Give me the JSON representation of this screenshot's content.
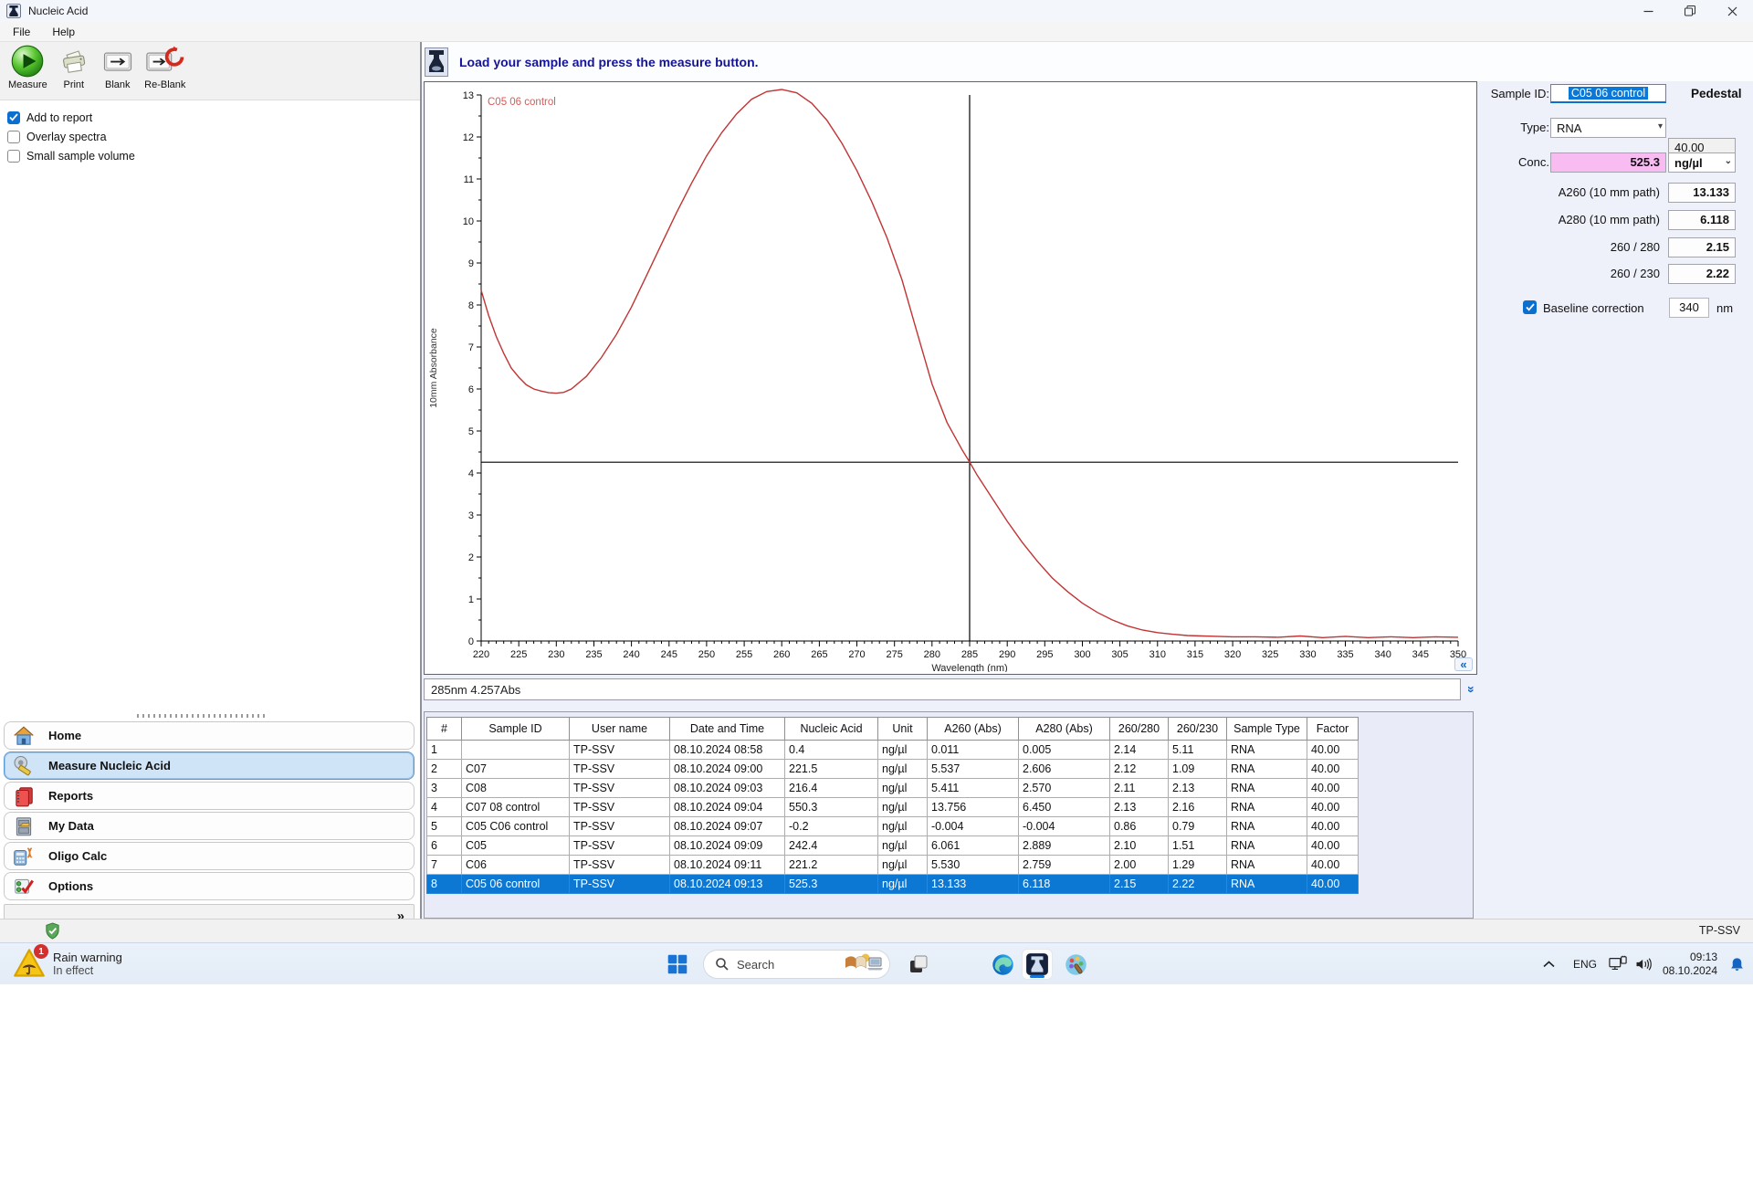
{
  "window": {
    "title": "Nucleic Acid",
    "menu": {
      "file": "File",
      "help": "Help"
    }
  },
  "toolbar": {
    "measure": "Measure",
    "print": "Print",
    "blank": "Blank",
    "reblank": "Re-Blank",
    "checkboxes": [
      {
        "label": "Add to report",
        "checked": true
      },
      {
        "label": "Overlay spectra",
        "checked": false
      },
      {
        "label": "Small sample volume",
        "checked": false
      }
    ]
  },
  "message": "Load your sample and press the measure button.",
  "chart_data": {
    "type": "line",
    "xlabel": "Wavelength (nm)",
    "ylabel": "10mm Absorbance",
    "xlim": [
      220,
      350
    ],
    "ylim": [
      0,
      13
    ],
    "x_major_tick": 5,
    "x_minor_tick": 1,
    "y_major_tick": 1,
    "y_minor_tick": 0.5,
    "grid": false,
    "legend_position": "top-left-inside",
    "series": [
      {
        "name": "C05 06 control",
        "color": "#c13434",
        "label_color": "#e05555",
        "points": [
          [
            220,
            8.35
          ],
          [
            221,
            7.75
          ],
          [
            222,
            7.25
          ],
          [
            223,
            6.85
          ],
          [
            224,
            6.5
          ],
          [
            225,
            6.28
          ],
          [
            226,
            6.1
          ],
          [
            227,
            6.0
          ],
          [
            228,
            5.95
          ],
          [
            229,
            5.91
          ],
          [
            230,
            5.9
          ],
          [
            231,
            5.92
          ],
          [
            232,
            6.0
          ],
          [
            234,
            6.3
          ],
          [
            236,
            6.75
          ],
          [
            238,
            7.3
          ],
          [
            240,
            7.95
          ],
          [
            242,
            8.7
          ],
          [
            244,
            9.45
          ],
          [
            246,
            10.2
          ],
          [
            248,
            10.9
          ],
          [
            250,
            11.55
          ],
          [
            252,
            12.1
          ],
          [
            254,
            12.55
          ],
          [
            256,
            12.9
          ],
          [
            258,
            13.08
          ],
          [
            260,
            13.13
          ],
          [
            262,
            13.05
          ],
          [
            264,
            12.8
          ],
          [
            266,
            12.4
          ],
          [
            268,
            11.85
          ],
          [
            270,
            11.2
          ],
          [
            272,
            10.45
          ],
          [
            274,
            9.6
          ],
          [
            276,
            8.6
          ],
          [
            278,
            7.35
          ],
          [
            280,
            6.12
          ],
          [
            282,
            5.2
          ],
          [
            284,
            4.55
          ],
          [
            285,
            4.26
          ],
          [
            286,
            3.95
          ],
          [
            288,
            3.4
          ],
          [
            290,
            2.85
          ],
          [
            292,
            2.35
          ],
          [
            294,
            1.9
          ],
          [
            296,
            1.5
          ],
          [
            298,
            1.18
          ],
          [
            300,
            0.9
          ],
          [
            302,
            0.68
          ],
          [
            304,
            0.5
          ],
          [
            306,
            0.36
          ],
          [
            308,
            0.26
          ],
          [
            310,
            0.2
          ],
          [
            312,
            0.16
          ],
          [
            314,
            0.13
          ],
          [
            316,
            0.12
          ],
          [
            318,
            0.11
          ],
          [
            320,
            0.1
          ],
          [
            323,
            0.1
          ],
          [
            326,
            0.09
          ],
          [
            329,
            0.12
          ],
          [
            332,
            0.08
          ],
          [
            335,
            0.11
          ],
          [
            338,
            0.08
          ],
          [
            341,
            0.1
          ],
          [
            344,
            0.08
          ],
          [
            347,
            0.1
          ],
          [
            350,
            0.09
          ]
        ]
      }
    ],
    "cursor": {
      "x": 285,
      "y": 4.257
    }
  },
  "cursor_readout": "285nm 4.257Abs",
  "results": {
    "sample_id_label": "Sample ID:",
    "sample_id_value": "C05 06 control",
    "mode": "Pedestal",
    "type_label": "Type:",
    "type_value": "RNA",
    "factor_value": "40.00",
    "conc_label": "Conc.",
    "conc_value": "525.3",
    "conc_unit": "ng/µl",
    "a260_label": "A260 (10 mm path)",
    "a260_value": "13.133",
    "a280_label": "A280 (10 mm path)",
    "a280_value": "6.118",
    "r280_label": "260 / 280",
    "r280_value": "2.15",
    "r230_label": "260 / 230",
    "r230_value": "2.22",
    "baseline_label": "Baseline correction",
    "baseline_checked": true,
    "baseline_value": "340",
    "baseline_unit": "nm"
  },
  "table": {
    "columns": [
      "#",
      "Sample ID",
      "User name",
      "Date and Time",
      "Nucleic Acid",
      "Unit",
      "A260 (Abs)",
      "A280 (Abs)",
      "260/280",
      "260/230",
      "Sample Type",
      "Factor"
    ],
    "selected_index": 7,
    "rows": [
      [
        "1",
        "",
        "TP-SSV",
        "08.10.2024 08:58",
        "0.4",
        "ng/µl",
        "0.011",
        "0.005",
        "2.14",
        "5.11",
        "RNA",
        "40.00"
      ],
      [
        "2",
        "C07",
        "TP-SSV",
        "08.10.2024 09:00",
        "221.5",
        "ng/µl",
        "5.537",
        "2.606",
        "2.12",
        "1.09",
        "RNA",
        "40.00"
      ],
      [
        "3",
        "C08",
        "TP-SSV",
        "08.10.2024 09:03",
        "216.4",
        "ng/µl",
        "5.411",
        "2.570",
        "2.11",
        "2.13",
        "RNA",
        "40.00"
      ],
      [
        "4",
        "C07 08 control",
        "TP-SSV",
        "08.10.2024 09:04",
        "550.3",
        "ng/µl",
        "13.756",
        "6.450",
        "2.13",
        "2.16",
        "RNA",
        "40.00"
      ],
      [
        "5",
        "C05 C06 control",
        "TP-SSV",
        "08.10.2024 09:07",
        "-0.2",
        "ng/µl",
        "-0.004",
        "-0.004",
        "0.86",
        "0.79",
        "RNA",
        "40.00"
      ],
      [
        "6",
        "C05",
        "TP-SSV",
        "08.10.2024 09:09",
        "242.4",
        "ng/µl",
        "6.061",
        "2.889",
        "2.10",
        "1.51",
        "RNA",
        "40.00"
      ],
      [
        "7",
        "C06",
        "TP-SSV",
        "08.10.2024 09:11",
        "221.2",
        "ng/µl",
        "5.530",
        "2.759",
        "2.00",
        "1.29",
        "RNA",
        "40.00"
      ],
      [
        "8",
        "C05 06 control",
        "TP-SSV",
        "08.10.2024 09:13",
        "525.3",
        "ng/µl",
        "13.133",
        "6.118",
        "2.15",
        "2.22",
        "RNA",
        "40.00"
      ]
    ]
  },
  "sidebar": {
    "items": [
      {
        "label": "Home",
        "icon": "home-icon",
        "selected": false
      },
      {
        "label": "Measure Nucleic Acid",
        "icon": "measure-nucleic-acid-icon",
        "selected": true
      },
      {
        "label": "Reports",
        "icon": "reports-icon",
        "selected": false
      },
      {
        "label": "My Data",
        "icon": "my-data-icon",
        "selected": false
      },
      {
        "label": "Oligo Calc",
        "icon": "oligo-calc-icon",
        "selected": false
      },
      {
        "label": "Options",
        "icon": "options-icon",
        "selected": false
      }
    ]
  },
  "app_status": {
    "user": "TP-SSV"
  },
  "taskbar": {
    "weather_title": "Rain warning",
    "weather_sub": "In effect",
    "weather_badge": "1",
    "search_placeholder": "Search",
    "language": "ENG",
    "time": "09:13",
    "date": "08.10.2024"
  },
  "colors": {
    "accent": "#0b6fd0",
    "selection": "#0d77d4",
    "pink_field": "#f8bcf2",
    "curve": "#c13434",
    "message_text": "#14149a"
  }
}
